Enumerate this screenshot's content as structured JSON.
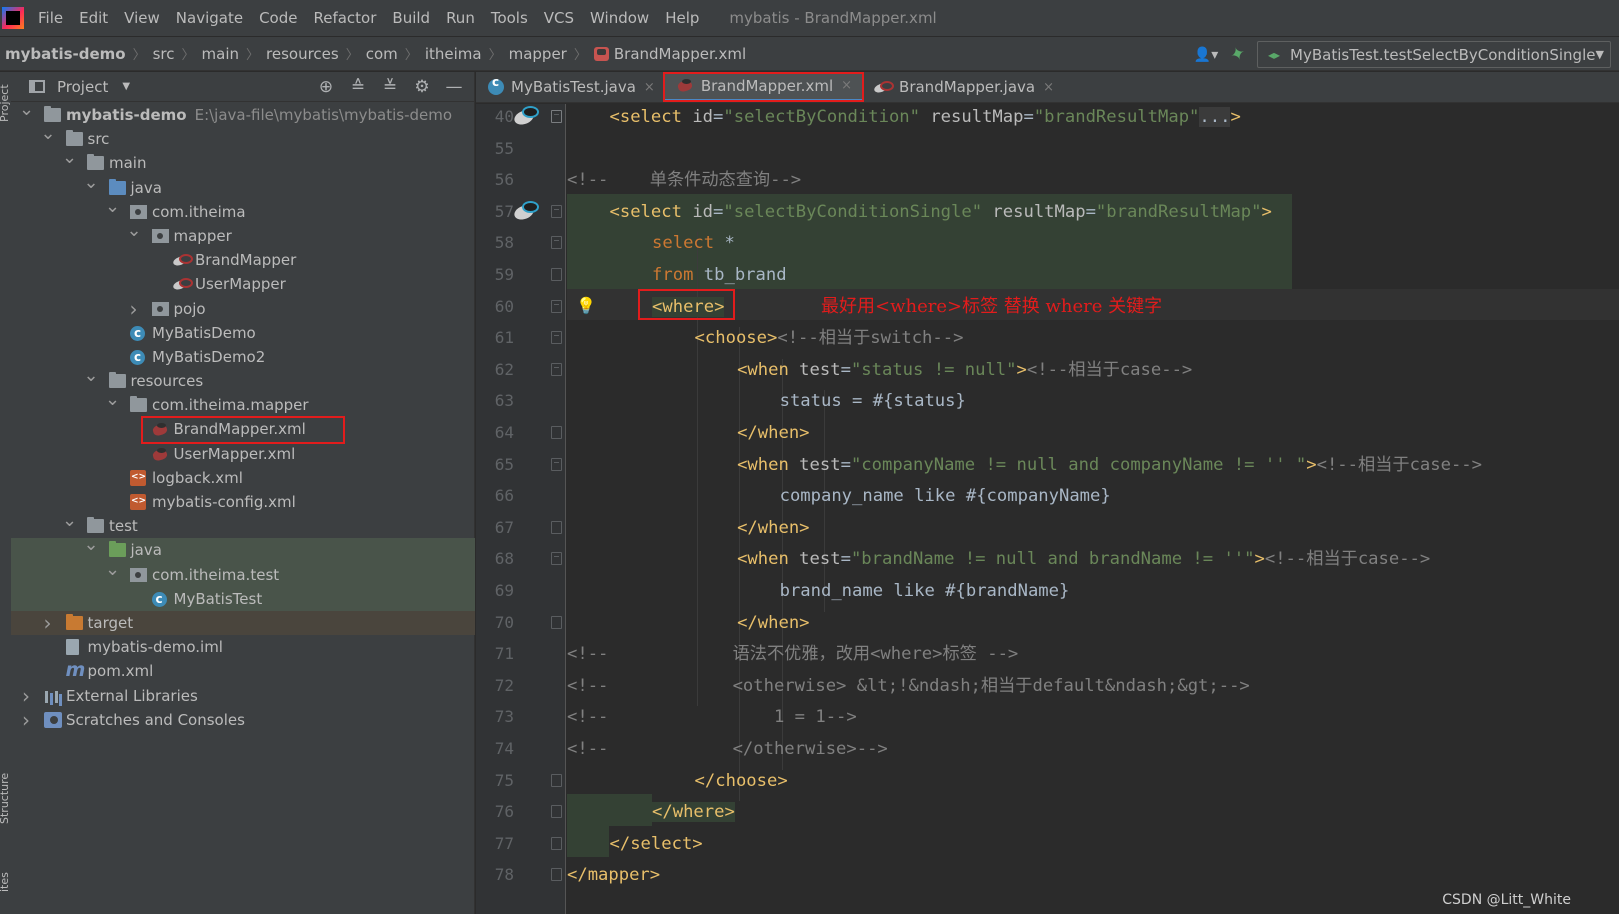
{
  "window": {
    "title": "mybatis - BrandMapper.xml",
    "menu": [
      "File",
      "Edit",
      "View",
      "Navigate",
      "Code",
      "Refactor",
      "Build",
      "Run",
      "Tools",
      "VCS",
      "Window",
      "Help"
    ]
  },
  "breadcrumbs": [
    "mybatis-demo",
    "src",
    "main",
    "resources",
    "com",
    "itheima",
    "mapper",
    "BrandMapper.xml"
  ],
  "run_config": "MyBatisTest.testSelectByConditionSingle",
  "left_strip": {
    "project_tab": "Project",
    "structure_tab": "Structure",
    "favorites_tab": "ites"
  },
  "project_panel": {
    "title": "Project",
    "tree": [
      {
        "label": "mybatis-demo",
        "path": "E:\\java-file\\mybatis\\mybatis-demo",
        "icon": "module-folder-icon",
        "expanded": true
      },
      {
        "label": "src",
        "icon": "folder-icon",
        "expanded": true
      },
      {
        "label": "main",
        "icon": "folder-icon",
        "expanded": true
      },
      {
        "label": "java",
        "icon": "source-folder-icon",
        "expanded": true
      },
      {
        "label": "com.itheima",
        "icon": "package-icon",
        "expanded": true
      },
      {
        "label": "mapper",
        "icon": "package-icon",
        "expanded": true
      },
      {
        "label": "BrandMapper",
        "icon": "mybatis-mapper-icon"
      },
      {
        "label": "UserMapper",
        "icon": "mybatis-mapper-icon"
      },
      {
        "label": "pojo",
        "icon": "package-icon",
        "expanded": false
      },
      {
        "label": "MyBatisDemo",
        "icon": "class-icon"
      },
      {
        "label": "MyBatisDemo2",
        "icon": "class-icon"
      },
      {
        "label": "resources",
        "icon": "resources-folder-icon",
        "expanded": true
      },
      {
        "label": "com.itheima.mapper",
        "icon": "folder-icon",
        "expanded": true
      },
      {
        "label": "BrandMapper.xml",
        "icon": "mybatis-xml-icon"
      },
      {
        "label": "UserMapper.xml",
        "icon": "mybatis-xml-icon"
      },
      {
        "label": "logback.xml",
        "icon": "config-xml-icon"
      },
      {
        "label": "mybatis-config.xml",
        "icon": "config-xml-icon"
      },
      {
        "label": "test",
        "icon": "folder-icon",
        "expanded": true
      },
      {
        "label": "java",
        "icon": "test-source-folder-icon",
        "expanded": true
      },
      {
        "label": "com.itheima.test",
        "icon": "package-icon",
        "expanded": true
      },
      {
        "label": "MyBatisTest",
        "icon": "class-icon"
      },
      {
        "label": "target",
        "icon": "excluded-folder-icon",
        "expanded": false
      },
      {
        "label": "mybatis-demo.iml",
        "icon": "iml-file-icon"
      },
      {
        "label": "pom.xml",
        "icon": "maven-icon"
      },
      {
        "label": "External Libraries",
        "icon": "libraries-icon",
        "expanded": false
      },
      {
        "label": "Scratches and Consoles",
        "icon": "scratches-icon",
        "expanded": false
      }
    ]
  },
  "editor_tabs": [
    {
      "label": "MyBatisTest.java",
      "icon": "class-icon",
      "active": false
    },
    {
      "label": "BrandMapper.xml",
      "icon": "mybatis-xml-icon",
      "active": true
    },
    {
      "label": "BrandMapper.java",
      "icon": "mybatis-mapper-icon",
      "active": false
    }
  ],
  "editor": {
    "lines": [
      {
        "n": "40",
        "segs": [
          [
            "tag",
            "<select "
          ],
          [
            "attr",
            "id"
          ],
          [
            "plain",
            "="
          ],
          [
            "str",
            "\"selectByCondition\""
          ],
          [
            "attr",
            " resultMap"
          ],
          [
            "plain",
            "="
          ],
          [
            "str",
            "\"brandResultMap\""
          ],
          [
            "plain",
            "..."
          ],
          [
            "tag",
            ">"
          ]
        ]
      },
      {
        "n": "55",
        "segs": []
      },
      {
        "n": "56",
        "segs": [
          [
            "cmt",
            "<!--    单条件动态查询-->"
          ]
        ]
      },
      {
        "n": "57",
        "segs": [
          [
            "tag",
            "<select "
          ],
          [
            "attr",
            "id"
          ],
          [
            "plain",
            "="
          ],
          [
            "str",
            "\"selectByConditionSingle\""
          ],
          [
            "attr",
            " resultMap"
          ],
          [
            "plain",
            "="
          ],
          [
            "str",
            "\"brandResultMap\""
          ],
          [
            "tag",
            ">"
          ]
        ]
      },
      {
        "n": "58",
        "segs": [
          [
            "kw",
            "select"
          ],
          [
            "plain",
            " *"
          ]
        ]
      },
      {
        "n": "59",
        "segs": [
          [
            "kw",
            "from"
          ],
          [
            "plain",
            " tb_brand"
          ]
        ]
      },
      {
        "n": "60",
        "segs": [
          [
            "tag",
            "<where>"
          ]
        ]
      },
      {
        "n": "61",
        "segs": [
          [
            "tag",
            "<choose>"
          ],
          [
            "cmt",
            "<!--相当于switch-->"
          ]
        ]
      },
      {
        "n": "62",
        "segs": [
          [
            "tag",
            "<when "
          ],
          [
            "attr",
            "test"
          ],
          [
            "plain",
            "="
          ],
          [
            "str",
            "\"status != null\""
          ],
          [
            "tag",
            ">"
          ],
          [
            "cmt",
            "<!--相当于case-->"
          ]
        ]
      },
      {
        "n": "63",
        "segs": [
          [
            "plain",
            "status = #{status}"
          ]
        ]
      },
      {
        "n": "64",
        "segs": [
          [
            "tag",
            "</when>"
          ]
        ]
      },
      {
        "n": "65",
        "segs": [
          [
            "tag",
            "<when "
          ],
          [
            "attr",
            "test"
          ],
          [
            "plain",
            "="
          ],
          [
            "str",
            "\"companyName != null and companyName != '' \""
          ],
          [
            "tag",
            ">"
          ],
          [
            "cmt",
            "<!--相当于case-->"
          ]
        ]
      },
      {
        "n": "66",
        "segs": [
          [
            "plain",
            "company_name like #{companyName}"
          ]
        ]
      },
      {
        "n": "67",
        "segs": [
          [
            "tag",
            "</when>"
          ]
        ]
      },
      {
        "n": "68",
        "segs": [
          [
            "tag",
            "<when "
          ],
          [
            "attr",
            "test"
          ],
          [
            "plain",
            "="
          ],
          [
            "str",
            "\"brandName != null and brandName != ''\""
          ],
          [
            "tag",
            ">"
          ],
          [
            "cmt",
            "<!--相当于case-->"
          ]
        ]
      },
      {
        "n": "69",
        "segs": [
          [
            "plain",
            "brand_name like #{brandName}"
          ]
        ]
      },
      {
        "n": "70",
        "segs": [
          [
            "tag",
            "</when>"
          ]
        ]
      },
      {
        "n": "71",
        "segs": [
          [
            "cmt",
            "<!--            语法不优雅，改用<where>标签 -->"
          ]
        ]
      },
      {
        "n": "72",
        "segs": [
          [
            "cmt",
            "<!--            <otherwise> &lt;!&ndash;相当于default&ndash;&gt;-->"
          ]
        ]
      },
      {
        "n": "73",
        "segs": [
          [
            "cmt",
            "<!--                1 = 1-->"
          ]
        ]
      },
      {
        "n": "74",
        "segs": [
          [
            "cmt",
            "<!--            </otherwise>-->"
          ]
        ]
      },
      {
        "n": "75",
        "segs": [
          [
            "tag",
            "</choose>"
          ]
        ]
      },
      {
        "n": "76",
        "segs": [
          [
            "tag",
            "</where>"
          ]
        ]
      },
      {
        "n": "77",
        "segs": [
          [
            "tag",
            "</select>"
          ]
        ]
      },
      {
        "n": "78",
        "segs": [
          [
            "tag",
            "</mapper>"
          ]
        ]
      }
    ],
    "annotation": "最好用<where>标签 替换 where 关键字",
    "watermark": "CSDN @Litt_White"
  },
  "colors": {
    "tag": "#e8bf6a",
    "attribute": "#bababa",
    "string": "#6a8759",
    "comment": "#808080",
    "keyword": "#cc7832",
    "highlight_box": "#e21c1c",
    "scope_highlight": "#344134"
  }
}
